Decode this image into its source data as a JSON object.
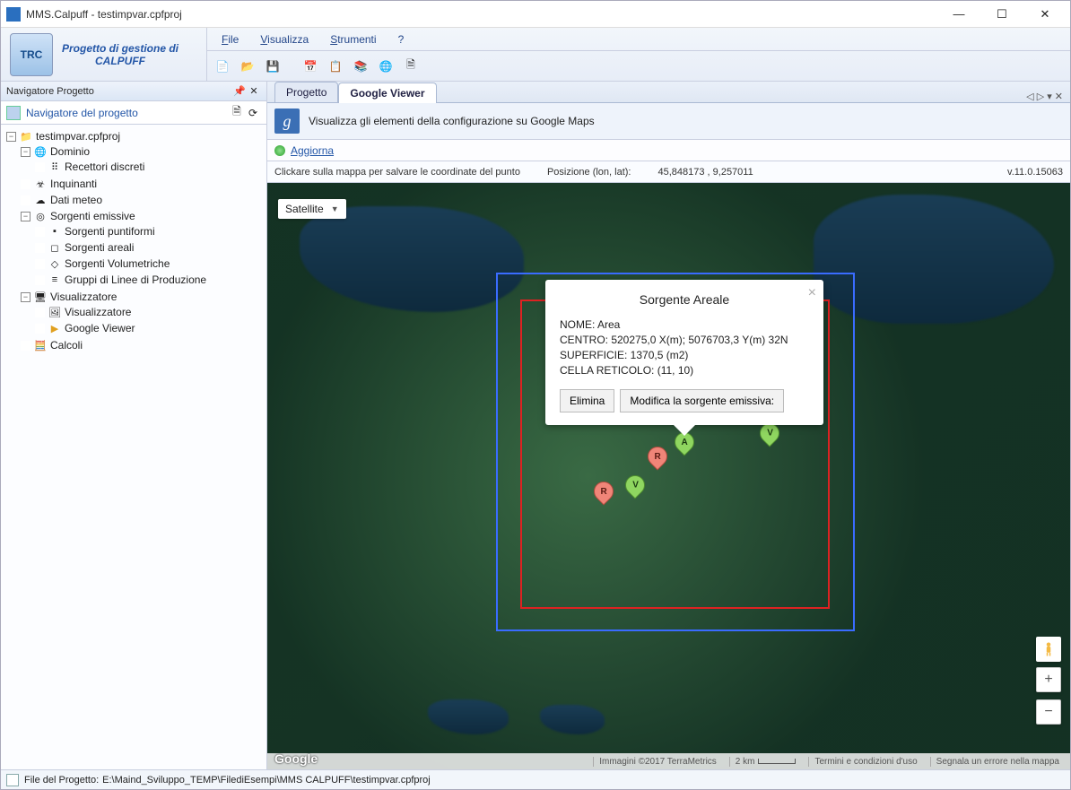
{
  "window": {
    "title": "MMS.Calpuff - testimpvar.cpfproj",
    "minimize": "—",
    "maximize": "☐",
    "close": "✕"
  },
  "brand": {
    "logo_text": "TRC",
    "title_line1": "Progetto di gestione di",
    "title_line2": "CALPUFF"
  },
  "menu": {
    "file": "File",
    "visualizza": "Visualizza",
    "strumenti": "Strumenti",
    "help": "?"
  },
  "sidebar": {
    "panel_title": "Navigatore Progetto",
    "header_label": "Navigatore del progetto",
    "tree": {
      "root": "testimpvar.cpfproj",
      "dominio": "Dominio",
      "recettori": "Recettori discreti",
      "inquinanti": "Inquinanti",
      "dati_meteo": "Dati meteo",
      "sorgenti": "Sorgenti emissive",
      "sorg_punt": "Sorgenti puntiformi",
      "sorg_area": "Sorgenti areali",
      "sorg_vol": "Sorgenti Volumetriche",
      "gruppi": "Gruppi di Linee di Produzione",
      "visualizzatore_grp": "Visualizzatore",
      "visualizzatore": "Visualizzatore",
      "google_viewer": "Google Viewer",
      "calcoli": "Calcoli"
    }
  },
  "tabs": {
    "progetto": "Progetto",
    "google_viewer": "Google Viewer"
  },
  "viewer": {
    "strip_text": "Visualizza gli elementi della configurazione su Google Maps",
    "refresh": "Aggiorna",
    "click_hint": "Clickare sulla mappa per salvare le coordinate del punto",
    "pos_label": "Posizione (lon, lat):",
    "pos_value": "45,848173 , 9,257011",
    "version": "v.11.0.15063"
  },
  "map": {
    "type_label": "Satellite",
    "infowindow": {
      "title": "Sorgente Areale",
      "line1": "NOME: Area",
      "line2": "CENTRO: 520275,0 X(m); 5076703,3 Y(m) 32N",
      "line3": "SUPERFICIE: 1370,5 (m2)",
      "line4": "CELLA RETICOLO: (11, 10)",
      "btn_elimina": "Elimina",
      "btn_modifica": "Modifica la sorgente emissiva:"
    },
    "footer": {
      "imagery": "Immagini ©2017 TerraMetrics",
      "scale": "2 km",
      "terms": "Termini e condizioni d'uso",
      "report": "Segnala un errore nella mappa",
      "logo": "Google"
    },
    "markers": {
      "A": "A",
      "V": "V",
      "R": "R"
    }
  },
  "status": {
    "label": "File del Progetto:",
    "path": "E:\\Maind_Sviluppo_TEMP\\FilediEsempi\\MMS CALPUFF\\testimpvar.cpfproj"
  }
}
